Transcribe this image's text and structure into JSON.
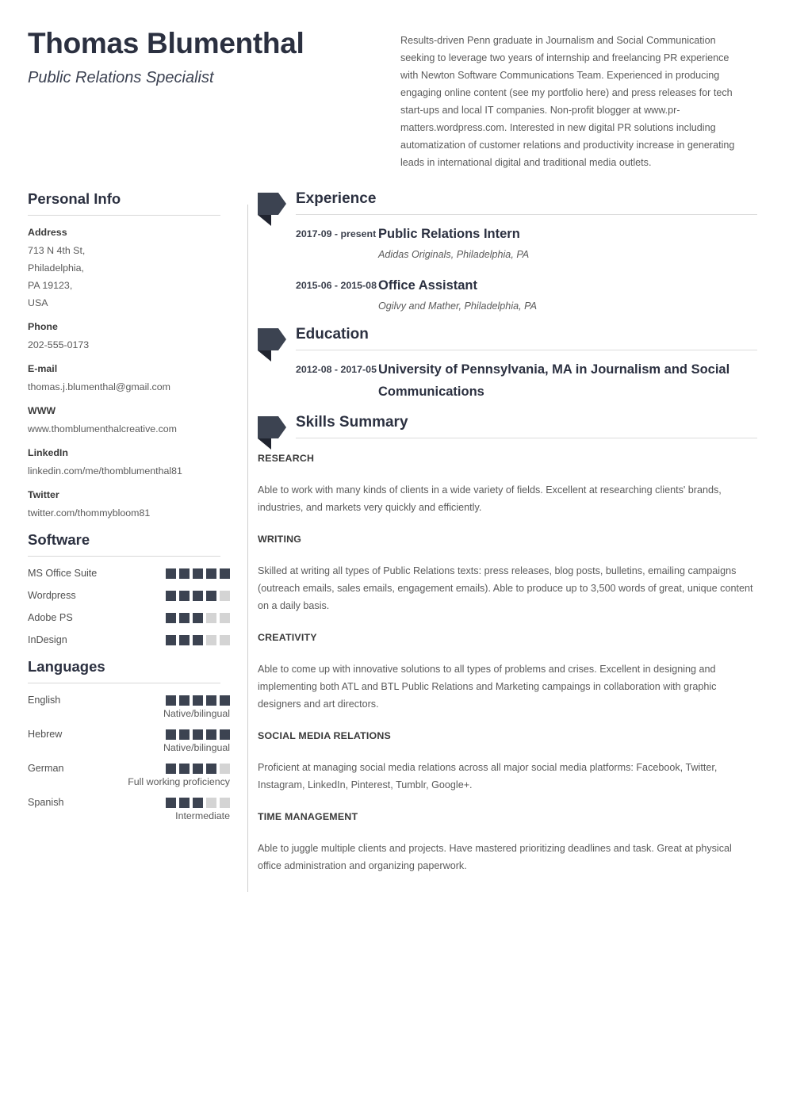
{
  "header": {
    "name": "Thomas Blumenthal",
    "job_title": "Public Relations Specialist",
    "summary": "Results-driven Penn graduate in Journalism and Social Communication seeking to leverage two years of internship and freelancing PR experience with Newton Software Communications Team. Experienced in producing engaging online content (see my portfolio here) and press releases for tech start-ups and local IT companies. Non-profit blogger at www.pr-matters.wordpress.com. Interested in new digital PR solutions including automatization of customer relations and productivity increase in generating leads in international digital and traditional media outlets."
  },
  "sidebar": {
    "personal_info": {
      "heading": "Personal Info",
      "fields": [
        {
          "label": "Address",
          "value": "713 N 4th St,\nPhiladelphia,\nPA 19123,\nUSA"
        },
        {
          "label": "Phone",
          "value": "202-555-0173"
        },
        {
          "label": "E-mail",
          "value": "thomas.j.blumenthal@gmail.com"
        },
        {
          "label": "WWW",
          "value": "www.thomblumenthalcreative.com"
        },
        {
          "label": "LinkedIn",
          "value": "linkedin.com/me/thomblumenthal81"
        },
        {
          "label": "Twitter",
          "value": "twitter.com/thommybloom81"
        }
      ]
    },
    "software": {
      "heading": "Software",
      "max": 5,
      "items": [
        {
          "name": "MS Office Suite",
          "rating": 5
        },
        {
          "name": "Wordpress",
          "rating": 4
        },
        {
          "name": "Adobe PS",
          "rating": 3
        },
        {
          "name": "InDesign",
          "rating": 3
        }
      ]
    },
    "languages": {
      "heading": "Languages",
      "max": 5,
      "items": [
        {
          "name": "English",
          "rating": 5,
          "level": "Native/bilingual"
        },
        {
          "name": "Hebrew",
          "rating": 5,
          "level": "Native/bilingual"
        },
        {
          "name": "German",
          "rating": 4,
          "level": "Full working proficiency"
        },
        {
          "name": "Spanish",
          "rating": 3,
          "level": "Intermediate"
        }
      ]
    }
  },
  "main": {
    "experience": {
      "heading": "Experience",
      "entries": [
        {
          "date": "2017-09 - present",
          "title": "Public Relations Intern",
          "subtitle": "Adidas Originals, Philadelphia, PA"
        },
        {
          "date": "2015-06 - 2015-08",
          "title": "Office Assistant",
          "subtitle": "Ogilvy and Mather, Philadelphia, PA"
        }
      ]
    },
    "education": {
      "heading": "Education",
      "entries": [
        {
          "date": "2012-08 - 2017-05",
          "title": "University of Pennsylvania, MA in Journalism and Social Communications",
          "subtitle": ""
        }
      ]
    },
    "skills_summary": {
      "heading": "Skills Summary",
      "blocks": [
        {
          "title": "RESEARCH",
          "text": "Able to work with many kinds of clients in a wide variety of fields. Excellent at researching clients' brands, industries, and markets very quickly and efficiently."
        },
        {
          "title": "WRITING",
          "text": "Skilled at writing all types of Public Relations texts: press releases, blog posts, bulletins, emailing campaigns (outreach emails, sales emails, engagement emails). Able to produce up to 3,500 words of great, unique content on a daily basis."
        },
        {
          "title": "CREATIVITY",
          "text": "Able to come up with innovative solutions to all types of problems and crises. Excellent in designing and implementing both ATL and BTL Public Relations and Marketing campaings in collaboration with graphic designers and art directors."
        },
        {
          "title": "SOCIAL MEDIA RELATIONS",
          "text": "Proficient at managing social media relations across all major social media platforms: Facebook, Twitter, Instagram, LinkedIn, Pinterest, Tumblr, Google+."
        },
        {
          "title": "TIME MANAGEMENT",
          "text": "Able to juggle multiple clients and projects. Have mastered prioritizing deadlines and task. Great at physical office administration and organizing paperwork."
        }
      ]
    }
  },
  "colors": {
    "dark_navy": "#2b3040",
    "marker": "#3c4351",
    "marker_fold": "#20242f",
    "square_on": "#3c4351",
    "square_off": "#d4d4d4",
    "rule": "#d8d8d8",
    "body_text": "#5a5a5a"
  }
}
